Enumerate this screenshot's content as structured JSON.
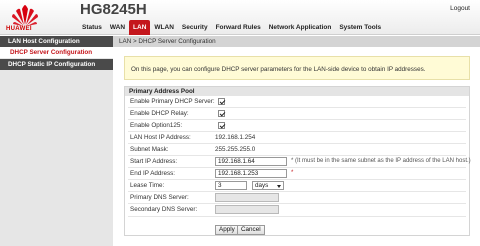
{
  "header": {
    "brand": "HUAWEI",
    "model": "HG8245H",
    "logout": "Logout",
    "nav": [
      "Status",
      "WAN",
      "LAN",
      "WLAN",
      "Security",
      "Forward Rules",
      "Network Application",
      "System Tools"
    ],
    "active_nav": "LAN"
  },
  "sidebar": {
    "section1": "LAN Host Configuration",
    "active_item": "DHCP Server Configuration",
    "section2": "DHCP Static IP Configuration"
  },
  "breadcrumb": "LAN > DHCP Server Configuration",
  "notice": "On this page, you can configure DHCP server parameters for the LAN-side device to obtain IP addresses.",
  "pool": {
    "title": "Primary Address Pool",
    "enable_primary_label": "Enable Primary DHCP Server:",
    "enable_relay_label": "Enable DHCP Relay:",
    "enable_option125_label": "Enable Option125:",
    "lan_ip_label": "LAN Host IP Address:",
    "lan_ip_value": "192.168.1.254",
    "subnet_label": "Subnet Mask:",
    "subnet_value": "255.255.255.0",
    "start_ip_label": "Start IP Address:",
    "start_ip_value": "192.168.1.64",
    "start_ip_hint": "* (It must be in the same subnet as the IP address of the LAN host.)",
    "end_ip_label": "End IP Address:",
    "end_ip_value": "192.168.1.253",
    "end_ip_hint": "*",
    "lease_label": "Lease Time:",
    "lease_value": "3",
    "lease_unit": "days",
    "primary_dns_label": "Primary DNS Server:",
    "secondary_dns_label": "Secondary DNS Server:",
    "primary_dns_value": "",
    "secondary_dns_value": ""
  },
  "buttons": {
    "apply": "Apply",
    "cancel": "Cancel"
  },
  "colors": {
    "accent": "#c4161c",
    "sidebar_header": "#4a4a4a",
    "notice_bg": "#fffbd6"
  }
}
